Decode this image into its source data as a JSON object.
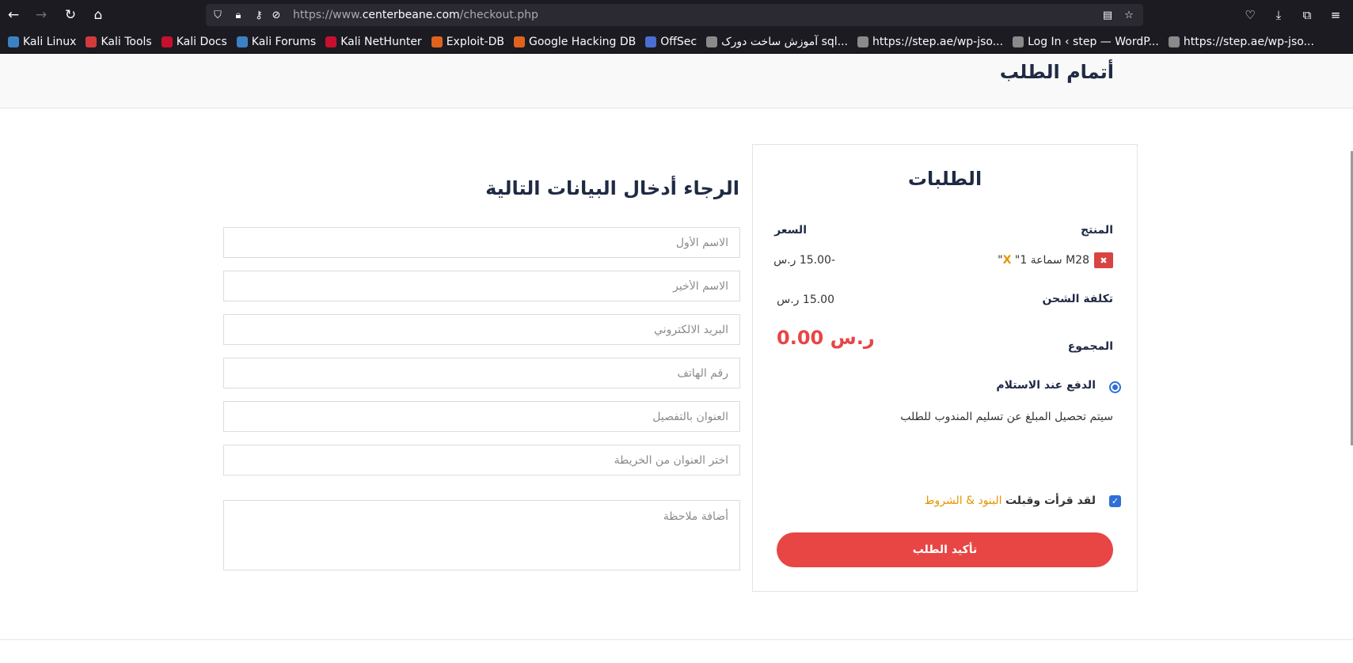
{
  "browser": {
    "url_prefix": "https://www.",
    "url_host": "centerbeane.com",
    "url_path": "/checkout.php"
  },
  "bookmarks": [
    {
      "label": "Kali Linux",
      "color": "#3b82c4"
    },
    {
      "label": "Kali Tools",
      "color": "#d23b3b"
    },
    {
      "label": "Kali Docs",
      "color": "#c8102e"
    },
    {
      "label": "Kali Forums",
      "color": "#3b82c4"
    },
    {
      "label": "Kali NetHunter",
      "color": "#c8102e"
    },
    {
      "label": "Exploit-DB",
      "color": "#e0631d"
    },
    {
      "label": "Google Hacking DB",
      "color": "#e0631d"
    },
    {
      "label": "OffSec",
      "color": "#4a6fd1"
    },
    {
      "label": "آموزش ساخت دورک sql...",
      "color": "#8a8a8a"
    },
    {
      "label": "https://step.ae/wp-jso...",
      "color": "#8a8a8a"
    },
    {
      "label": "Log In ‹ step — WordP...",
      "color": "#8a8a8a"
    },
    {
      "label": "https://step.ae/wp-jso...",
      "color": "#8a8a8a"
    }
  ],
  "page": {
    "header_title": "أتمام الطلب"
  },
  "order": {
    "title": "الطلبات",
    "col_product": "المنتج",
    "col_price": "السعر",
    "item_name": "M28 سماعة",
    "item_x": "X",
    "item_qty": "\"1\"",
    "item_price": "-15.00 ر.س",
    "shipping_label": "تكلفة الشحن",
    "shipping_value": "15.00 ر.س",
    "total_label": "المجموع",
    "total_value": "0.00 ر.س",
    "payment_label": "الدفع عند الاستلام",
    "payment_note": "سيتم تحصيل المبلغ عن تسليم المندوب للطلب",
    "terms_prefix": "لقد قرأت وقبلت",
    "terms_link": "البنود & الشروط",
    "confirm_button": "تأكيد الطلب",
    "accent_color": "#e84545"
  },
  "form": {
    "title": "الرجاء أدخال البيانات التالية",
    "first_name_placeholder": "الاسم الأول",
    "last_name_placeholder": "الاسم الأخير",
    "email_placeholder": "البريد الالكتروني",
    "phone_placeholder": "رقم الهاتف",
    "address_placeholder": "العنوان بالتفصيل",
    "map_placeholder": "اختر العنوان من الخريطة",
    "note_placeholder": "أضافة ملاحظة"
  }
}
